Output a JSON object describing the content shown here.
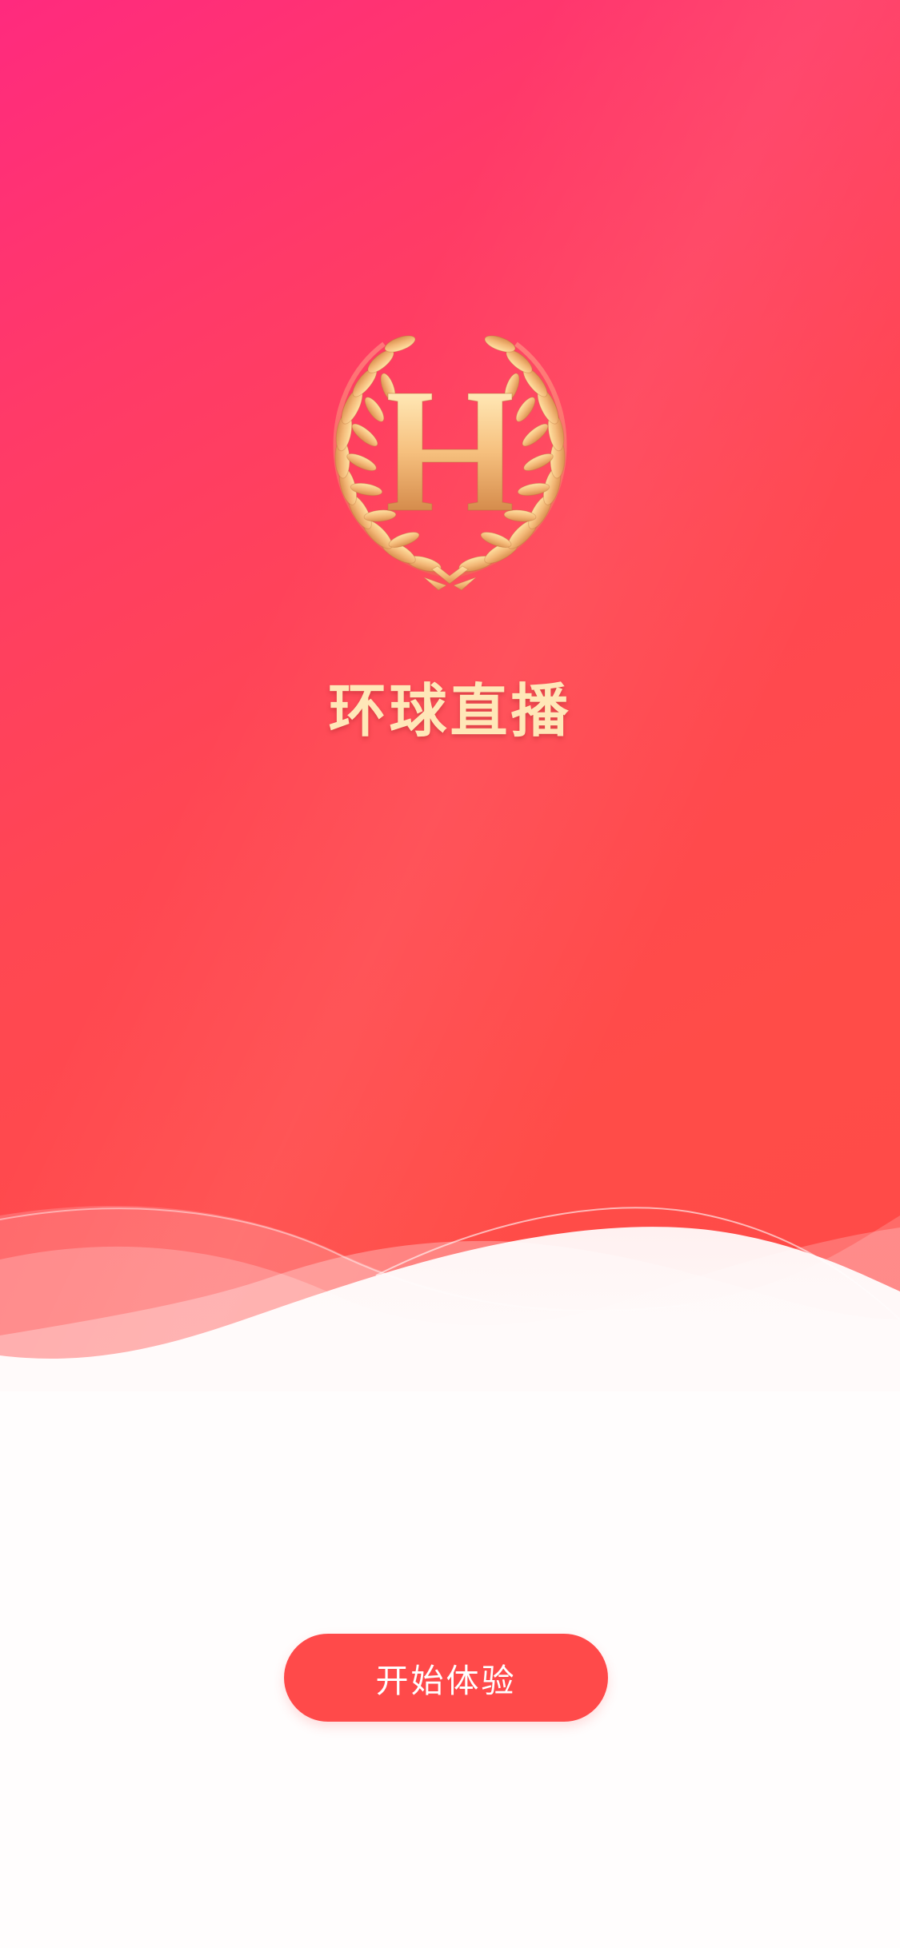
{
  "app": {
    "title": "环球直播",
    "logo_icon": "laurel-wreath-h-icon",
    "logo_letter": "H"
  },
  "actions": {
    "start_label": "开始体验"
  },
  "colors": {
    "gradient_start": "#ff2a7e",
    "gradient_end": "#ff4a47",
    "title_gold": "#ffe7b8",
    "button_red": "#ff4a4a",
    "button_text": "#ffffff",
    "logo_gold_light": "#ffe2a3",
    "logo_gold_dark": "#d9904f"
  }
}
